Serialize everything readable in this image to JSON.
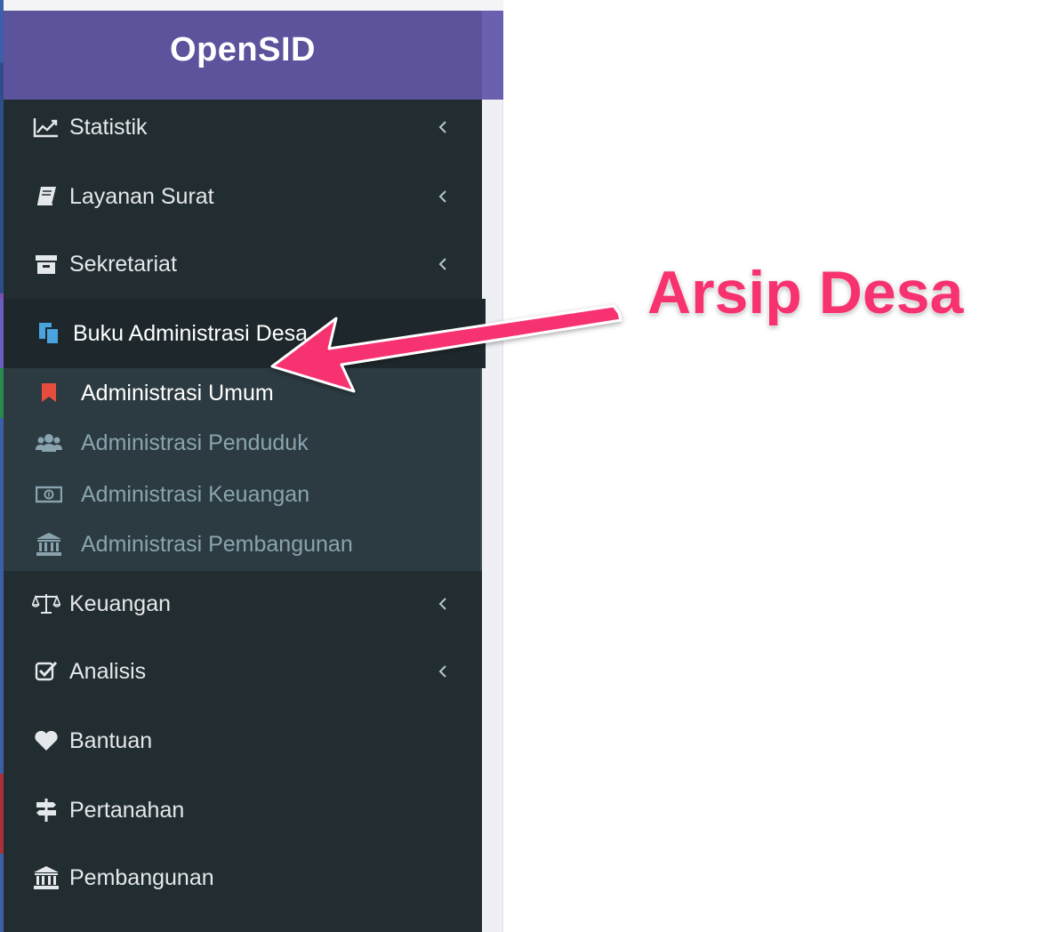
{
  "brand": {
    "title": "OpenSID",
    "color": "#5b539c"
  },
  "sidebar": {
    "background": "#222d32",
    "items": [
      {
        "label": "Statistik",
        "icon": "line-chart-icon",
        "has_chevron": true,
        "chevron": "left"
      },
      {
        "label": "Layanan Surat",
        "icon": "book-icon",
        "has_chevron": true,
        "chevron": "left"
      },
      {
        "label": "Sekretariat",
        "icon": "archive-icon",
        "has_chevron": true,
        "chevron": "left"
      },
      {
        "label": "Buku Administrasi Desa",
        "icon": "copy-icon",
        "has_chevron": true,
        "chevron": "down",
        "expanded": true
      },
      {
        "label": "Keuangan",
        "icon": "balance-scale-icon",
        "has_chevron": true,
        "chevron": "left"
      },
      {
        "label": "Analisis",
        "icon": "check-square-icon",
        "has_chevron": true,
        "chevron": "left"
      },
      {
        "label": "Bantuan",
        "icon": "heart-icon",
        "has_chevron": false
      },
      {
        "label": "Pertanahan",
        "icon": "signpost-icon",
        "has_chevron": false
      },
      {
        "label": "Pembangunan",
        "icon": "bank-icon",
        "has_chevron": false
      }
    ],
    "submenu": [
      {
        "label": "Administrasi Umum",
        "icon": "bookmark-icon",
        "current": true
      },
      {
        "label": "Administrasi Penduduk",
        "icon": "users-icon",
        "current": false
      },
      {
        "label": "Administrasi Keuangan",
        "icon": "money-icon",
        "current": false
      },
      {
        "label": "Administrasi Pembangunan",
        "icon": "bank-icon",
        "current": false
      }
    ]
  },
  "annotation": {
    "text": "Arsip Desa",
    "color": "#f7326f"
  }
}
